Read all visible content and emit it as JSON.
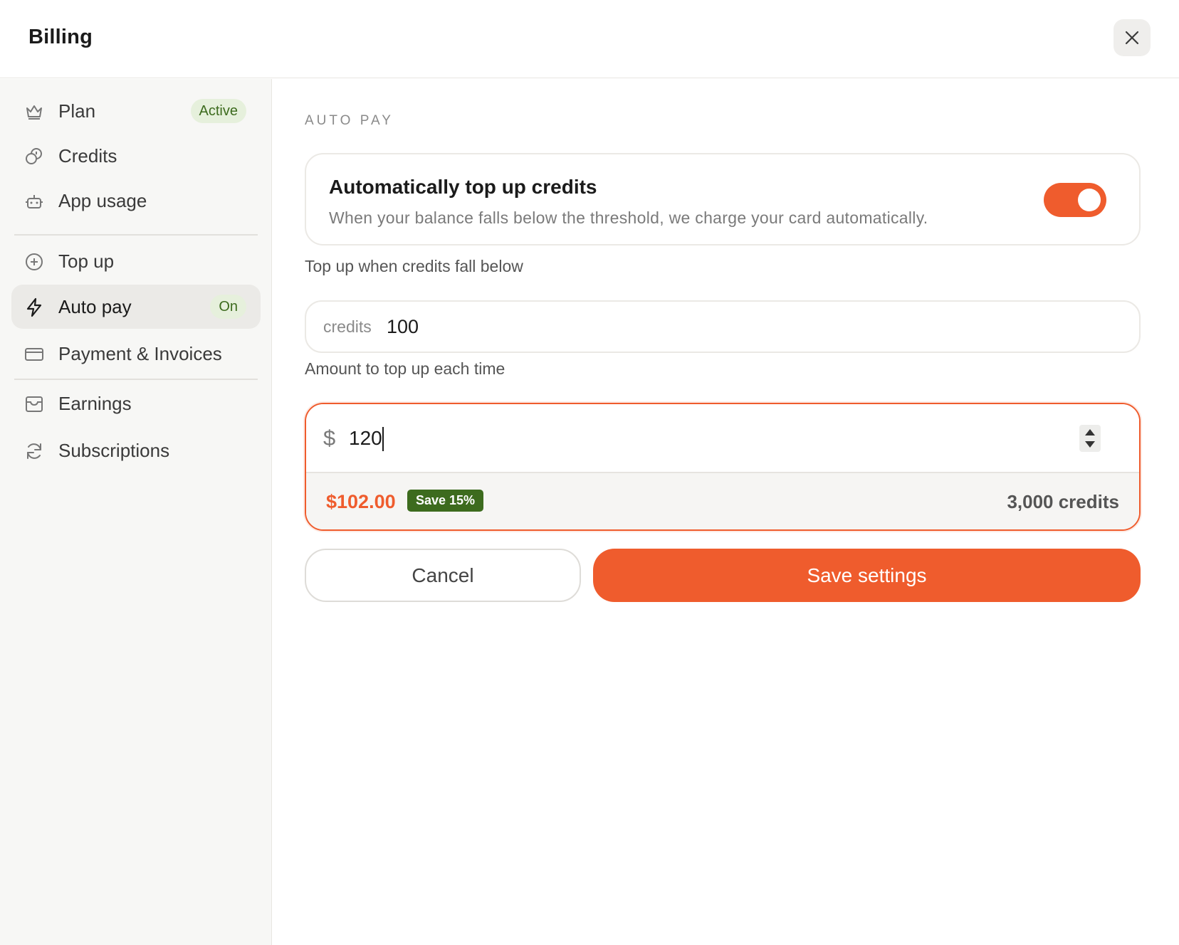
{
  "header": {
    "title": "Billing",
    "close_icon": "close-icon"
  },
  "sidebar": {
    "items": [
      {
        "label": "Plan",
        "icon": "crown-icon",
        "badge": "Active"
      },
      {
        "label": "Credits",
        "icon": "coins-icon"
      },
      {
        "label": "App usage",
        "icon": "robot-icon"
      },
      {
        "label": "Top up",
        "icon": "plus-circle-icon"
      },
      {
        "label": "Auto pay",
        "icon": "lightning-icon",
        "badge": "On",
        "active": true
      },
      {
        "label": "Payment & Invoices",
        "icon": "credit-card-icon"
      },
      {
        "label": "Earnings",
        "icon": "inbox-icon"
      },
      {
        "label": "Subscriptions",
        "icon": "refresh-icon"
      }
    ]
  },
  "main": {
    "section_title": "AUTO PAY",
    "auto_topup": {
      "title": "Automatically top up credits",
      "description": "When your balance falls below the threshold, we charge your card automatically.",
      "enabled": true
    },
    "threshold": {
      "label": "Top up when credits fall below",
      "prefix": "credits",
      "value": "100"
    },
    "amount": {
      "label": "Amount to top up each time",
      "currency": "$",
      "value": "120",
      "price": "$102.00",
      "discount_badge": "Save 15%",
      "credits_total": "3,000 credits"
    },
    "buttons": {
      "cancel": "Cancel",
      "save": "Save settings"
    }
  },
  "colors": {
    "accent": "#ef5c2d",
    "badge_green_bg": "#e6f0dc",
    "badge_green_text": "#3d6b1e",
    "save_badge_bg": "#3d6b1e"
  }
}
